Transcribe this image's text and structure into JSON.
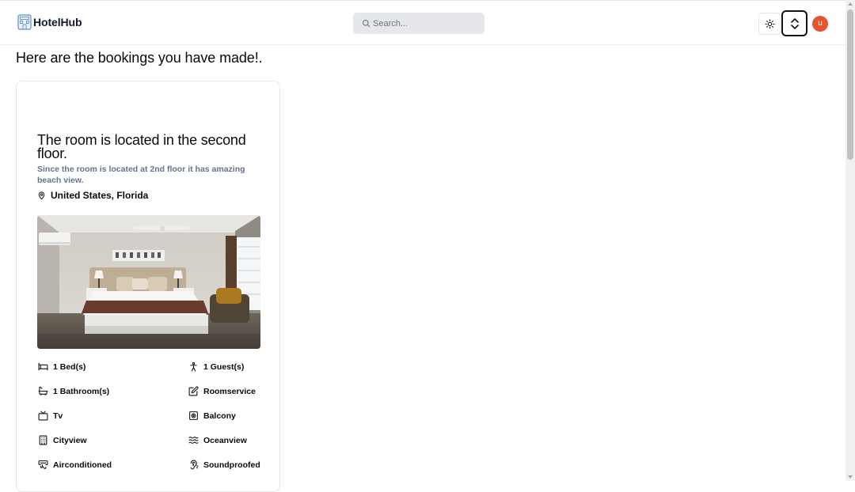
{
  "app": {
    "name": "HotelHub"
  },
  "header": {
    "search_placeholder": "Search...",
    "avatar_initial": "u"
  },
  "page": {
    "heading": "Here are the bookings you have made!."
  },
  "booking": {
    "title": "The room is located in the second floor.",
    "description": "Since the room is located at 2nd floor it has amazing beach view.",
    "location": "United States, Florida",
    "amenities": [
      {
        "icon": "bed-icon",
        "label": "1 Bed(s)"
      },
      {
        "icon": "person-icon",
        "label": "1 Guest(s)"
      },
      {
        "icon": "bath-icon",
        "label": "1 Bathroom(s)"
      },
      {
        "icon": "room-service-icon",
        "label": "Roomservice"
      },
      {
        "icon": "tv-icon",
        "label": "Tv"
      },
      {
        "icon": "balcony-icon",
        "label": "Balcony"
      },
      {
        "icon": "building-icon",
        "label": "Cityview"
      },
      {
        "icon": "waves-icon",
        "label": "Oceanview"
      },
      {
        "icon": "air-vent-icon",
        "label": "Airconditioned"
      },
      {
        "icon": "ear-off-icon",
        "label": "Soundproofed"
      }
    ]
  },
  "colors": {
    "accent": "#e4572e",
    "search_bg": "#e5e7eb",
    "muted_text": "#64748b"
  }
}
